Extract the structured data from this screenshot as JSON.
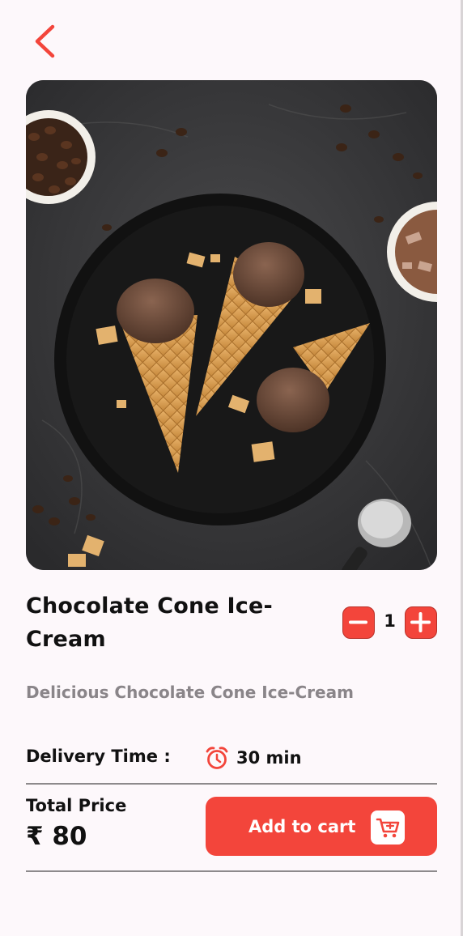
{
  "header": {
    "back_icon": "chevron-left-icon"
  },
  "product": {
    "image": "chocolate-cone-ice-cream-photo",
    "title": "Chocolate Cone Ice-Cream",
    "description": "Delicious Chocolate Cone Ice-Cream"
  },
  "quantity": {
    "value": "1",
    "minus_icon": "minus-icon",
    "plus_icon": "plus-icon"
  },
  "delivery": {
    "label": "Delivery Time :",
    "icon": "alarm-clock-icon",
    "value": "30 min"
  },
  "price": {
    "label": "Total Price",
    "value": "₹ 80"
  },
  "cart": {
    "label": "Add to cart",
    "icon": "shopping-cart-icon"
  },
  "colors": {
    "accent": "#f3453b",
    "background": "#fdf8fb",
    "muted_text": "#8a8589",
    "divider": "#8d8a8c"
  }
}
